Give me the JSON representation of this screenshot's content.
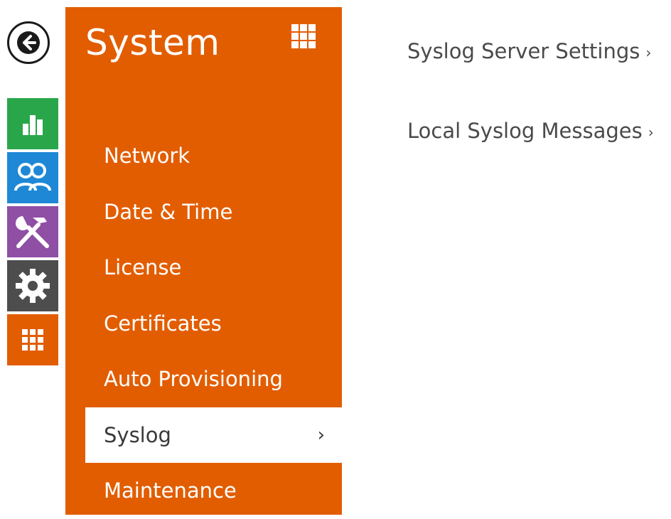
{
  "colors": {
    "panel_orange": "#e25d00",
    "status_green": "#2aa64a",
    "users_blue": "#1e88d6",
    "services_purple": "#8f4fa5",
    "system_gray": "#4d4d4d",
    "apps_orange": "#e25d00"
  },
  "rail": {
    "back_icon": "arrow-left-icon",
    "items": [
      {
        "icon": "bar-chart-icon",
        "color": "#2aa64a"
      },
      {
        "icon": "users-icon",
        "color": "#1e88d6"
      },
      {
        "icon": "tools-icon",
        "color": "#8f4fa5"
      },
      {
        "icon": "gear-icon",
        "color": "#4d4d4d"
      },
      {
        "icon": "grid-icon",
        "color": "#e25d00"
      }
    ]
  },
  "panel": {
    "title": "System",
    "apps_icon": "grid-icon",
    "menu": [
      {
        "label": "Network"
      },
      {
        "label": "Date & Time"
      },
      {
        "label": "License"
      },
      {
        "label": "Certificates"
      },
      {
        "label": "Auto Provisioning"
      },
      {
        "label": "Syslog",
        "active": true,
        "chevron": "›"
      },
      {
        "label": "Maintenance"
      }
    ]
  },
  "content": {
    "links": [
      {
        "label": "Syslog Server Settings",
        "chevron": "›"
      },
      {
        "label": "Local Syslog Messages",
        "chevron": "›"
      }
    ]
  }
}
